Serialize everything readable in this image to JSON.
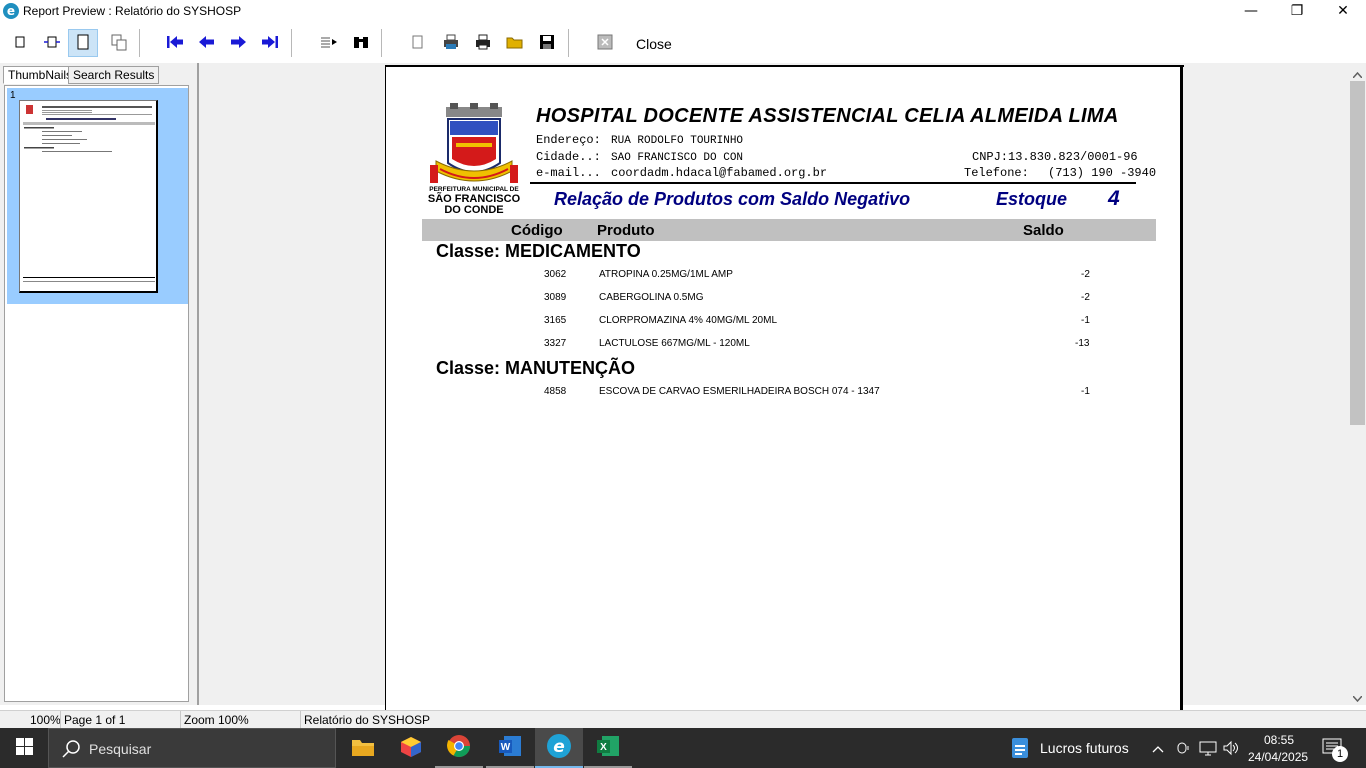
{
  "window": {
    "title": "Report Preview : Relatório do SYSHOSP",
    "app_icon": "e",
    "minimize": "—",
    "maximize": "❐",
    "close": "✕"
  },
  "toolbar": {
    "close_label": "Close"
  },
  "left_panel": {
    "tabs": [
      "ThumbNails",
      "Search Results"
    ],
    "thumb_number": "1"
  },
  "report": {
    "logo_text": [
      "PERFEITURA MUNICIPAL DE",
      "SÃO FRANCISCO",
      "DO CONDE"
    ],
    "hospital_name": "HOSPITAL DOCENTE ASSISTENCIAL CELIA ALMEIDA LIMA",
    "endereco_label": "Endereço:",
    "endereco_value": "RUA RODOLFO TOURINHO",
    "cidade_label": "Cidade..:",
    "cidade_value": "SAO FRANCISCO DO CON",
    "cnpj": "CNPJ:13.830.823/0001-96",
    "email_label": "e-mail...",
    "email_value": "coordadm.hdacal@fabamed.org.br",
    "telefone_label": "Telefone:",
    "telefone_value": "(713) 190 -3940",
    "title": "Relação de Produtos com Saldo Negativo",
    "estoque_label": "Estoque",
    "estoque_value": "4",
    "columns": {
      "codigo": "Código",
      "produto": "Produto",
      "saldo": "Saldo"
    },
    "groups": [
      {
        "classe": "Classe: MEDICAMENTO",
        "rows": [
          {
            "codigo": "3062",
            "produto": "ATROPINA 0.25MG/1ML AMP",
            "saldo": "-2"
          },
          {
            "codigo": "3089",
            "produto": "CABERGOLINA 0.5MG",
            "saldo": "-2"
          },
          {
            "codigo": "3165",
            "produto": "CLORPROMAZINA 4% 40MG/ML 20ML",
            "saldo": "-1"
          },
          {
            "codigo": "3327",
            "produto": "LACTULOSE 667MG/ML - 120ML",
            "saldo": "-13"
          }
        ]
      },
      {
        "classe": "Classe: MANUTENÇÃO",
        "rows": [
          {
            "codigo": "4858",
            "produto": "ESCOVA DE CARVAO ESMERILHADEIRA BOSCH 074 - 1347",
            "saldo": "-1"
          }
        ]
      }
    ]
  },
  "statusbar": {
    "zoom_pct": "100%",
    "page": "Page 1 of 1",
    "zoom": "Zoom 100%",
    "report_name": "Relatório do SYSHOSP"
  },
  "taskbar": {
    "search_placeholder": "Pesquisar",
    "widget_text": "Lucros futuros",
    "time": "08:55",
    "date": "24/04/2025",
    "notification_count": "1"
  },
  "colors": {
    "report_title": "#000080",
    "column_header_bg": "#c0c0c0",
    "toolbar_arrow": "#1a1ad6",
    "thumb_selection": "#99ccff",
    "taskbar_bg": "#2b2b2b"
  }
}
